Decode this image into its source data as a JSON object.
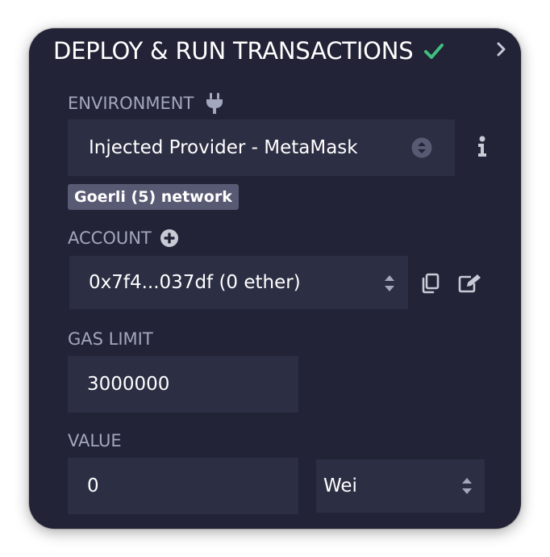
{
  "header": {
    "title": "DEPLOY & RUN TRANSACTIONS"
  },
  "environment": {
    "label": "ENVIRONMENT",
    "value": "Injected Provider - MetaMask",
    "network_badge": "Goerli (5) network"
  },
  "account": {
    "label": "ACCOUNT",
    "value": "0x7f4...037df (0 ether)"
  },
  "gas_limit": {
    "label": "GAS LIMIT",
    "value": "3000000"
  },
  "value": {
    "label": "VALUE",
    "amount": "0",
    "unit": "Wei"
  },
  "colors": {
    "panel_bg": "#222336",
    "field_bg": "#2c2e43",
    "label_text": "#a3a7bd",
    "check_green": "#3fbf7f",
    "badge_bg": "#585a73"
  },
  "icons": {
    "check": "check-icon",
    "chevron": "chevron-right-icon",
    "plug": "plug-icon",
    "info": "info-icon",
    "plus_circle": "plus-circle-icon",
    "copy": "copy-icon",
    "edit": "edit-icon"
  }
}
